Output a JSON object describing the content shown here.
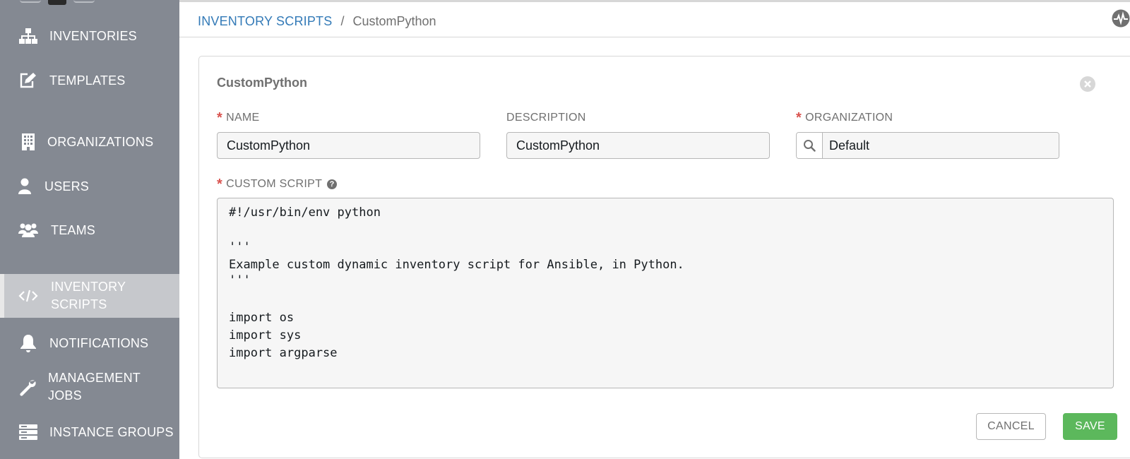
{
  "sidebar": {
    "items": [
      {
        "label": "INVENTORIES",
        "icon": "sitemap-icon"
      },
      {
        "label": "TEMPLATES",
        "icon": "pencil-square-icon"
      },
      {
        "label": "ORGANIZATIONS",
        "icon": "building-icon"
      },
      {
        "label": "USERS",
        "icon": "user-icon"
      },
      {
        "label": "TEAMS",
        "icon": "users-icon"
      },
      {
        "label_lines": [
          "INVENTORY",
          "SCRIPTS"
        ],
        "icon": "code-icon",
        "active": true
      },
      {
        "label": "NOTIFICATIONS",
        "icon": "bell-icon"
      },
      {
        "label_lines": [
          "MANAGEMENT",
          "JOBS"
        ],
        "icon": "wrench-icon"
      },
      {
        "label": "INSTANCE GROUPS",
        "icon": "server-icon"
      }
    ]
  },
  "breadcrumb": {
    "parent": "INVENTORY SCRIPTS",
    "separator": "/",
    "current": "CustomPython"
  },
  "form": {
    "title": "CustomPython",
    "name": {
      "label": "NAME",
      "required": true,
      "value": "CustomPython"
    },
    "description": {
      "label": "DESCRIPTION",
      "required": false,
      "value": "CustomPython"
    },
    "organization": {
      "label": "ORGANIZATION",
      "required": true,
      "value": "Default"
    },
    "custom_script": {
      "label": "CUSTOM SCRIPT",
      "required": true,
      "lines": [
        "#!/usr/bin/env python",
        "'''",
        "Example custom dynamic inventory script for Ansible, in Python.",
        "'''",
        "import os",
        "import sys",
        "import argparse"
      ]
    },
    "cancel_label": "CANCEL",
    "save_label": "SAVE"
  },
  "colors": {
    "sidebar_bg": "#848992",
    "sidebar_active_bg": "#c6c8cc",
    "link": "#337ab7",
    "required": "#d9534f",
    "save_button": "#5cb85c"
  }
}
